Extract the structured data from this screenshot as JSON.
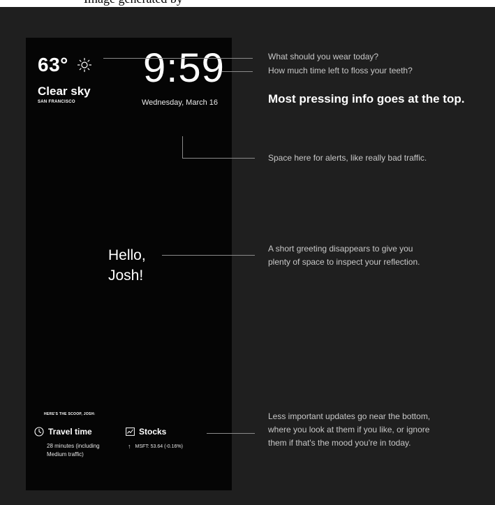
{
  "top_strip": {
    "text": "Image generated by"
  },
  "mirror": {
    "weather": {
      "temperature": "63°",
      "condition": "Clear sky",
      "location": "SAN FRANCISCO",
      "icon": "sun-icon"
    },
    "clock": {
      "time": "9:59",
      "date": "Wednesday, March 16"
    },
    "greeting": {
      "line1": "Hello,",
      "line2": "Josh!"
    },
    "scoop_label": "HERE'S THE SCOOP, JOSH:",
    "travel": {
      "title": "Travel time",
      "detail_line1": "28 minutes (including",
      "detail_line2": "Medium traffic)",
      "icon": "clock-icon"
    },
    "stocks": {
      "title": "Stocks",
      "detail": "MSFT: 53.64 (-0.16%)",
      "icon": "chart-icon",
      "arrow": "↑"
    }
  },
  "annotations": {
    "wear": "What should you wear today?",
    "floss": "How much time left to floss your teeth?",
    "pressing": "Most pressing info goes at the top.",
    "alerts": "Space here for alerts, like really bad traffic.",
    "greeting_line1": "A short greeting disappears to give you",
    "greeting_line2": "plenty of space to inspect your reflection.",
    "bottom_line1": "Less important updates go near the bottom,",
    "bottom_line2": "where you look at them if you like, or ignore",
    "bottom_line3": "them if that's the mood you're in today."
  },
  "colors": {
    "background": "#1f1f1f",
    "mirror": "#050505",
    "text": "#ffffff",
    "annotation": "#c8c8c8",
    "leader": "#8a8a8a"
  }
}
